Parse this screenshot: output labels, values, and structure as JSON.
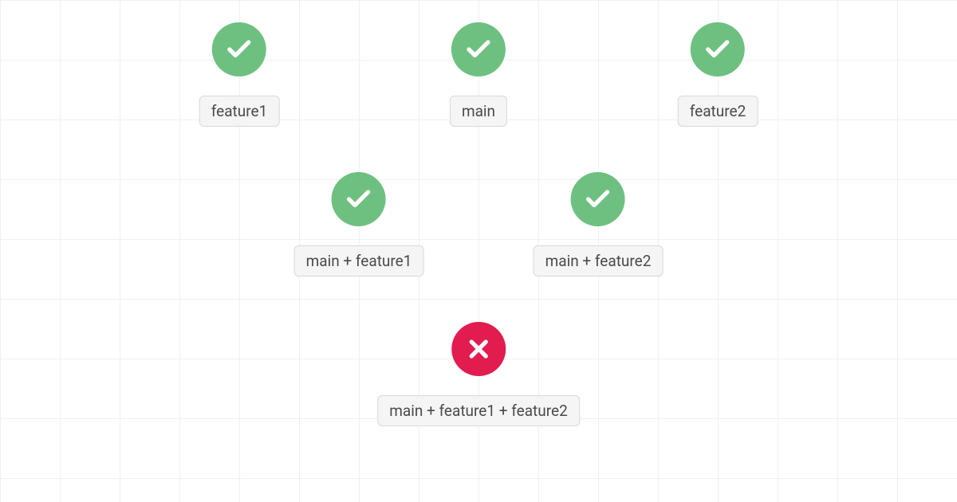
{
  "nodes": {
    "row1": {
      "left": {
        "label": "feature1",
        "status": "success"
      },
      "center": {
        "label": "main",
        "status": "success"
      },
      "right": {
        "label": "feature2",
        "status": "success"
      }
    },
    "row2": {
      "left": {
        "label": "main + feature1",
        "status": "success"
      },
      "right": {
        "label": "main + feature2",
        "status": "success"
      }
    },
    "row3": {
      "center": {
        "label": "main + feature1 + feature2",
        "status": "failure"
      }
    }
  },
  "colors": {
    "success": "#6ec081",
    "failure": "#e21c4e",
    "label_bg": "#f5f5f5",
    "label_border": "#d8d8d8",
    "grid": "#f0f0f0"
  }
}
